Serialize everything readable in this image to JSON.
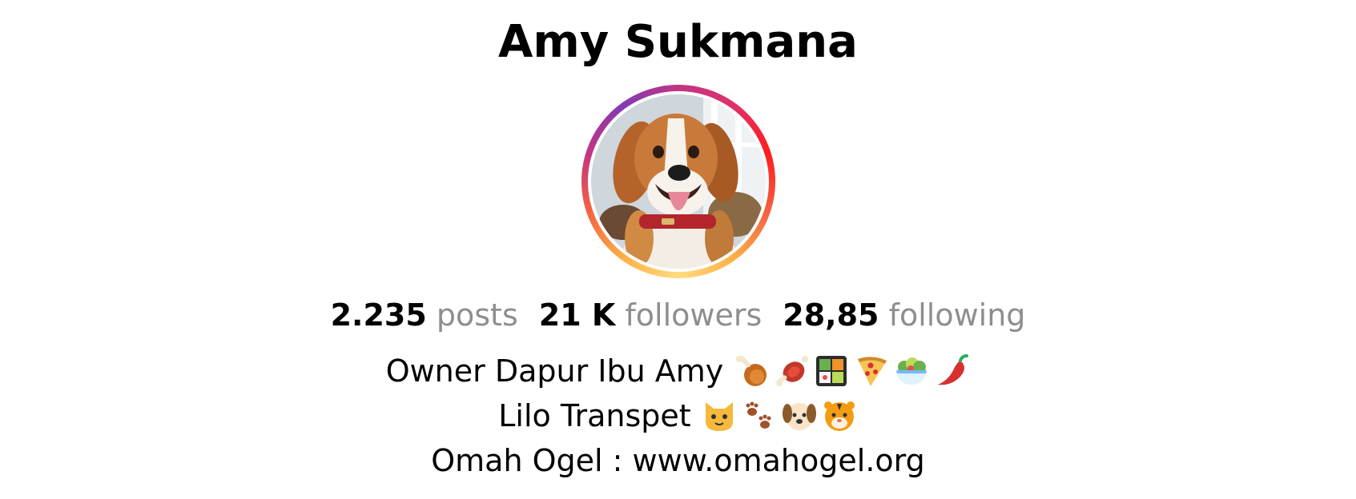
{
  "profile": {
    "name": "Amy Sukmana",
    "avatar_icon": "beagle-dog-avatar",
    "ring_colors": [
      "#c13584",
      "#e1306c",
      "#fd1d1d",
      "#f56040",
      "#fcaf45"
    ]
  },
  "stats": {
    "posts_value": "2.235",
    "posts_label": "posts",
    "followers_value": "21 K",
    "followers_label": "followers",
    "following_value": "28,85",
    "following_label": "following"
  },
  "bio": {
    "line1_text": "Owner Dapur Ibu Amy",
    "line1_emojis": [
      "poultry-leg-icon",
      "meat-on-bone-icon",
      "bento-box-icon",
      "pizza-icon",
      "salad-icon",
      "hot-pepper-icon"
    ],
    "line2_text": "Lilo Transpet",
    "line2_emojis": [
      "cat-face-icon",
      "paw-prints-icon",
      "dog-face-icon",
      "tiger-face-icon"
    ],
    "line3_text": "Omah Ogel : www.omahogel.org"
  },
  "colors": {
    "text": "#000000",
    "muted": "#8e8e8e",
    "background": "#ffffff"
  }
}
